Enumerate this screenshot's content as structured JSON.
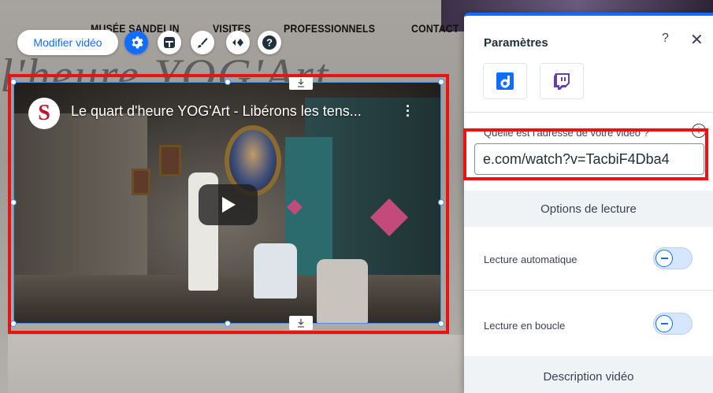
{
  "site": {
    "nav": [
      "MUSÉE SANDELIN",
      "VISITES",
      "PROFESSIONNELS",
      "CONTACT"
    ],
    "title_fragment": "l'heure YOG'Art"
  },
  "toolbar": {
    "edit_video_label": "Modifier vidéo",
    "tools": [
      "settings-icon",
      "layout-icon",
      "design-brush-icon",
      "animation-icon",
      "help-icon"
    ]
  },
  "video": {
    "title": "Le quart d'heure YOG'Art - Libérons les tens...",
    "channel_logo": "S"
  },
  "panel": {
    "title": "Paramètres",
    "help": "?",
    "close": "✕",
    "sources": [
      "dailymotion-icon",
      "twitch-icon"
    ],
    "url_label": "Quelle est l'adresse de votre vidéo ?",
    "url_value": "e.com/watch?v=TacbiF4Dba4",
    "playback_section": "Options de lecture",
    "autoplay_label": "Lecture automatique",
    "loop_label": "Lecture en boucle",
    "description_section": "Description vidéo"
  },
  "colors": {
    "accent": "#116dff",
    "highlight": "#ee1111"
  }
}
